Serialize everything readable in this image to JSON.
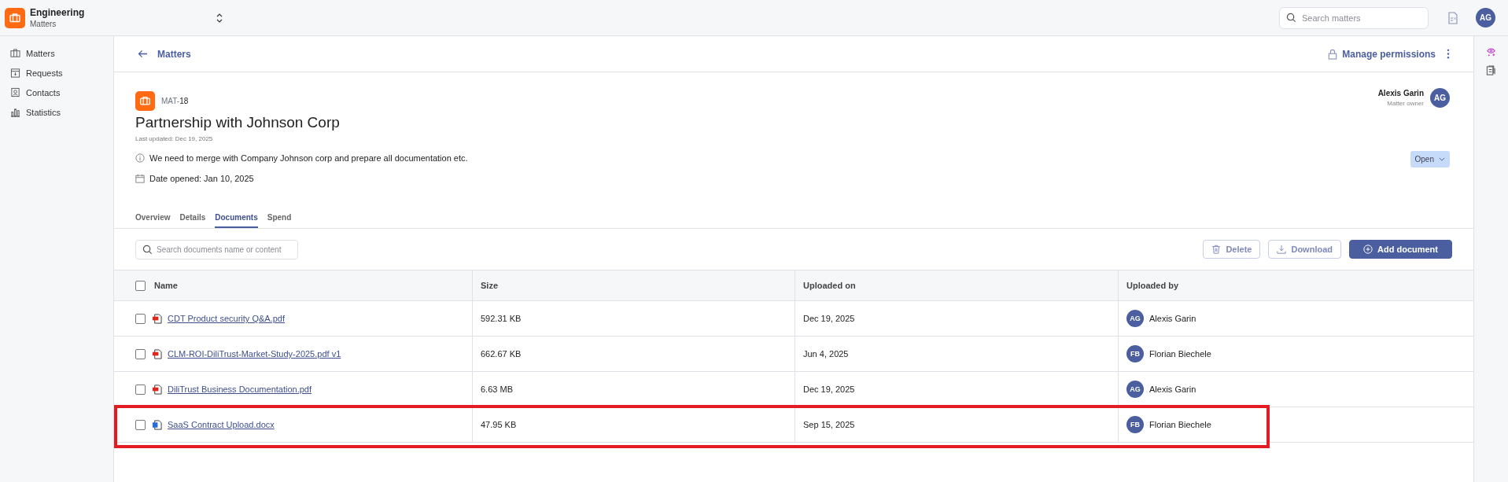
{
  "app": {
    "workspace": "Engineering",
    "section": "Matters"
  },
  "search": {
    "placeholder": "Search matters"
  },
  "user": {
    "initials": "AG"
  },
  "sidebar": {
    "items": [
      {
        "label": "Matters"
      },
      {
        "label": "Requests"
      },
      {
        "label": "Contacts"
      },
      {
        "label": "Statistics"
      }
    ]
  },
  "back_link": "Matters",
  "manage_permissions": "Manage permissions",
  "matter": {
    "id": "MAT-**18**",
    "title": "Partnership with Johnson Corp",
    "last_updated": "Last updated: Dec 19, 2025",
    "description": "We need to merge with Company Johnson corp and prepare all documentation etc.",
    "date_opened": "Date opened: Jan 10, 2025",
    "owner": {
      "name": "Alexis Garin",
      "role": "Matter owner",
      "initials": "AG"
    },
    "status": "Open"
  },
  "tabs": [
    {
      "label": "Overview",
      "selected": false
    },
    {
      "label": "Details",
      "selected": false
    },
    {
      "label": "Documents",
      "selected": true
    },
    {
      "label": "Spend",
      "selected": false
    }
  ],
  "documents": {
    "search": {
      "placeholder": "Search documents name or content"
    },
    "actions": [
      {
        "kind": "delete",
        "label": "Delete",
        "disabled": true
      },
      {
        "kind": "download",
        "label": "Download",
        "disabled": true
      },
      {
        "kind": "add",
        "label": "Add document",
        "disabled": false
      }
    ],
    "all_checked": false,
    "columns": [
      "Name",
      "Size",
      "Uploaded on",
      "Uploaded by"
    ],
    "rows": [
      {
        "kind": "pdf",
        "name": "CDT Product security Q&A.pdf",
        "size": "592.31 KB",
        "uploaded_on": "Dec 19, 2025",
        "uploader": {
          "initials": "AG",
          "name": "Alexis Garin"
        },
        "checked": false,
        "highlighted": false
      },
      {
        "kind": "pdf",
        "name": "CLM-ROI-DiliTrust-Market-Study-2025.pdf v1",
        "size": "662.67 KB",
        "uploaded_on": "Jun 4, 2025",
        "uploader": {
          "initials": "FB",
          "name": "Florian Biechele"
        },
        "checked": false,
        "highlighted": false
      },
      {
        "kind": "pdf",
        "name": "DiliTrust Business Documentation.pdf",
        "size": "6.63 MB",
        "uploaded_on": "Dec 19, 2025",
        "uploader": {
          "initials": "AG",
          "name": "Alexis Garin"
        },
        "checked": false,
        "highlighted": false
      },
      {
        "kind": "docx",
        "name": "SaaS Contract Upload.docx",
        "size": "47.95 KB",
        "uploaded_on": "Sep 15, 2025",
        "uploader": {
          "initials": "FB",
          "name": "Florian Biechele"
        },
        "checked": false,
        "highlighted": true
      }
    ]
  }
}
